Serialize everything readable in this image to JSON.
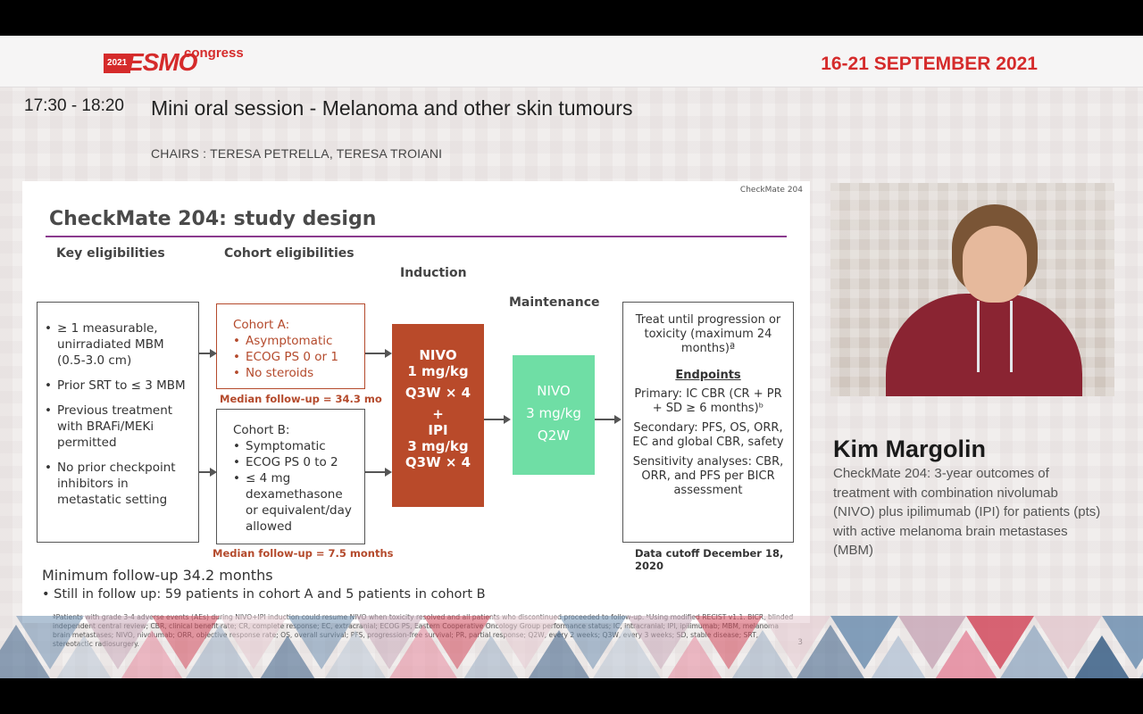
{
  "header": {
    "logo_year": "2021",
    "logo_brand": "ESMO",
    "logo_suffix": "congress",
    "dates": "16-21 SEPTEMBER 2021"
  },
  "session": {
    "time": "17:30 - 18:20",
    "title": "Mini oral session - Melanoma and other skin tumours",
    "chairs": "CHAIRS : TERESA PETRELLA, TERESA TROIANI"
  },
  "slide": {
    "tag": "CheckMate 204",
    "title": "CheckMate 204: study design",
    "key_heading": "Key eligibilities",
    "key_items": [
      "≥ 1 measurable, unirradiated MBM (0.5-3.0 cm)",
      "Prior SRT to ≤ 3 MBM",
      "Previous treatment with BRAFi/MEKi permitted",
      "No prior checkpoint inhibitors in metastatic setting"
    ],
    "cohort_heading": "Cohort eligibilities",
    "cohort_a_title": "Cohort A:",
    "cohort_a_items": [
      "Asymptomatic",
      "ECOG PS 0 or 1",
      "No steroids"
    ],
    "cohort_a_followup": "Median follow-up = 34.3 mo",
    "cohort_b_title": "Cohort B:",
    "cohort_b_items": [
      "Symptomatic",
      "ECOG PS 0 to 2",
      "≤ 4 mg dexamethasone or equivalent/day allowed"
    ],
    "cohort_b_followup": "Median follow-up = 7.5 months",
    "induction_heading": "Induction",
    "induction_lines": [
      "NIVO",
      "1 mg/kg",
      "Q3W × 4",
      "+",
      "IPI",
      "3 mg/kg",
      "Q3W × 4"
    ],
    "maintenance_heading": "Maintenance",
    "maintenance_lines": [
      "NIVO",
      "3 mg/kg",
      "Q2W"
    ],
    "treat_until": "Treat until progression or toxicity (maximum 24 months)ª",
    "endpoints_heading": "Endpoints",
    "primary": "Primary: IC CBR (CR + PR + SD ≥ 6 months)ᵇ",
    "secondary": "Secondary: PFS, OS, ORR, EC and global CBR, safety",
    "sensitivity": "Sensitivity analyses: CBR, ORR, and PFS per BICR assessment",
    "data_cutoff": "Data cutoff December 18, 2020",
    "min_followup": "Minimum follow-up 34.2 months",
    "still_followup": "Still in follow up: 59 patients in cohort A and 5 patients in cohort B",
    "footnote": "ªPatients with grade 3-4 adverse events (AEs) during NIVO+IPI induction could resume NIVO when toxicity resolved and all patients who discontinued proceeded to follow-up. ᵇUsing modified RECIST v1.1. BICR, blinded independent central review; CBR, clinical benefit rate; CR, complete response; EC, extracranial; ECOG PS, Eastern Cooperative Oncology Group performance status; IC, intracranial; IPI, ipilimumab; MBM, melanoma brain metastases; NIVO, nivolumab; ORR, objective response rate; OS, overall survival; PFS, progression-free survival; PR, partial response; Q2W, every 2 weeks; Q3W, every 3 weeks; SD, stable disease; SRT, stereotactic radiosurgery.",
    "page_number": "3"
  },
  "speaker": {
    "name": "Kim Margolin",
    "talk_title": "CheckMate 204: 3-year outcomes of treatment with combination nivolumab (NIVO) plus ipilimumab (IPI) for patients (pts) with active melanoma brain metastases (MBM)"
  },
  "colors": {
    "brand_red": "#d52b2b",
    "induction": "#b94a2a",
    "maintenance": "#6fdea5",
    "title_rule": "#8a3a8e"
  }
}
